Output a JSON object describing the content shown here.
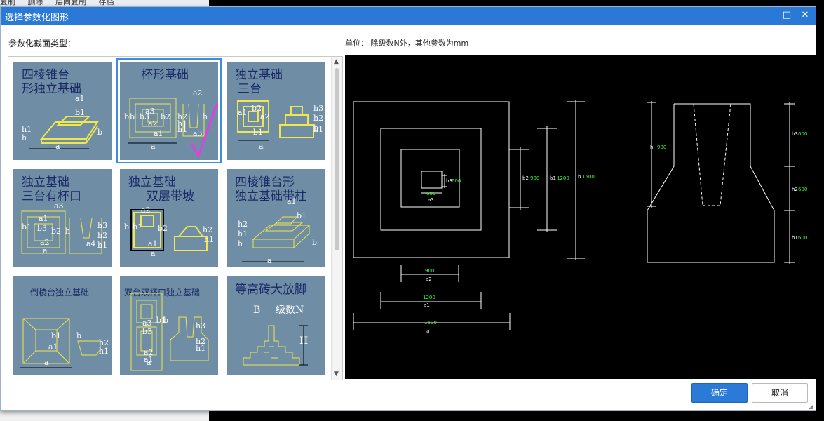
{
  "background": {
    "toolbar_items": [
      "复制",
      "删除",
      "层间复制",
      "存档"
    ]
  },
  "dialog": {
    "title": "选择参数化图形",
    "section_label": "参数化截面类型：",
    "unit_label": "单位：  除级数N外，其他参数为mm",
    "buttons": {
      "ok": "确定",
      "cancel": "取消"
    },
    "accent": "#2b79d6"
  },
  "shapes": [
    {
      "l1": "四棱锥台",
      "l2": "形独立基础",
      "labels": [
        "a1",
        "b1",
        "h1",
        "h",
        "b",
        "a"
      ]
    },
    {
      "l1": "杯形基础",
      "l2": "",
      "labels": [
        "a2",
        "a3",
        "b3",
        "b2",
        "h2",
        "h",
        "h1",
        "a1",
        "a",
        "b",
        "b1",
        "a2",
        "h1",
        "a3"
      ]
    },
    {
      "l1": "独立基础",
      "l2": "三台",
      "labels": [
        "b2",
        "a1",
        "a2",
        "a",
        "b1",
        "h3",
        "h2",
        "h1",
        "b"
      ]
    },
    {
      "l1": "独立基础",
      "l2": "三台有杯口",
      "labels": [
        "a3",
        "b1",
        "b3",
        "a1",
        "b2",
        "a2",
        "a",
        "h",
        "a4",
        "h3",
        "h2",
        "h1"
      ]
    },
    {
      "l1": "独立基础",
      "l2": "双层带坡",
      "labels": [
        "a2",
        "b",
        "b1",
        "b2",
        "a1",
        "a",
        "h2",
        "h1"
      ]
    },
    {
      "l1": "四棱锥台形",
      "l2": "独立基础带柱",
      "labels": [
        "a1",
        "b1",
        "h2",
        "h1",
        "h",
        "b",
        "a"
      ]
    },
    {
      "l1": "倒棱台独立基础",
      "l2": "",
      "labels": [
        "b1",
        "a1",
        "b",
        "h2",
        "h1",
        "a"
      ]
    },
    {
      "l1": "双台双杯口独立基础",
      "l2": "",
      "labels": [
        "a3",
        "b3",
        "b1",
        "b",
        "h3",
        "h2",
        "h1",
        "a1",
        "a2",
        "a"
      ]
    },
    {
      "l1": "等高砖大放脚",
      "l2": "",
      "labels": [
        "B",
        "级数N",
        "H"
      ]
    }
  ],
  "preview": {
    "plan": {
      "b3": "600",
      "a3": "600",
      "b2": "900",
      "b1": "1200",
      "b": "1500",
      "a2": "900",
      "a1": "1200",
      "a": "1500",
      "lab_b3": "b3",
      "lab_a3": "a3",
      "lab_b2": "b2",
      "lab_b1": "b1",
      "lab_b": "b",
      "lab_a2": "a2",
      "lab_a1": "a1",
      "lab_a": "a"
    },
    "section": {
      "h": "900",
      "h3": "600",
      "h2": "600",
      "h1": "600",
      "lab_h": "h",
      "lab_h3": "h3",
      "lab_h2": "h2",
      "lab_h1": "h1"
    }
  },
  "colors": {
    "thumb_bg": "#6f8ea6",
    "thumb_text": "#1a2a66",
    "thumb_line": "#f1e64a",
    "thumb_label": "#ffffff",
    "dim_value": "#3bff3b",
    "check_mark": "#e040e0"
  }
}
